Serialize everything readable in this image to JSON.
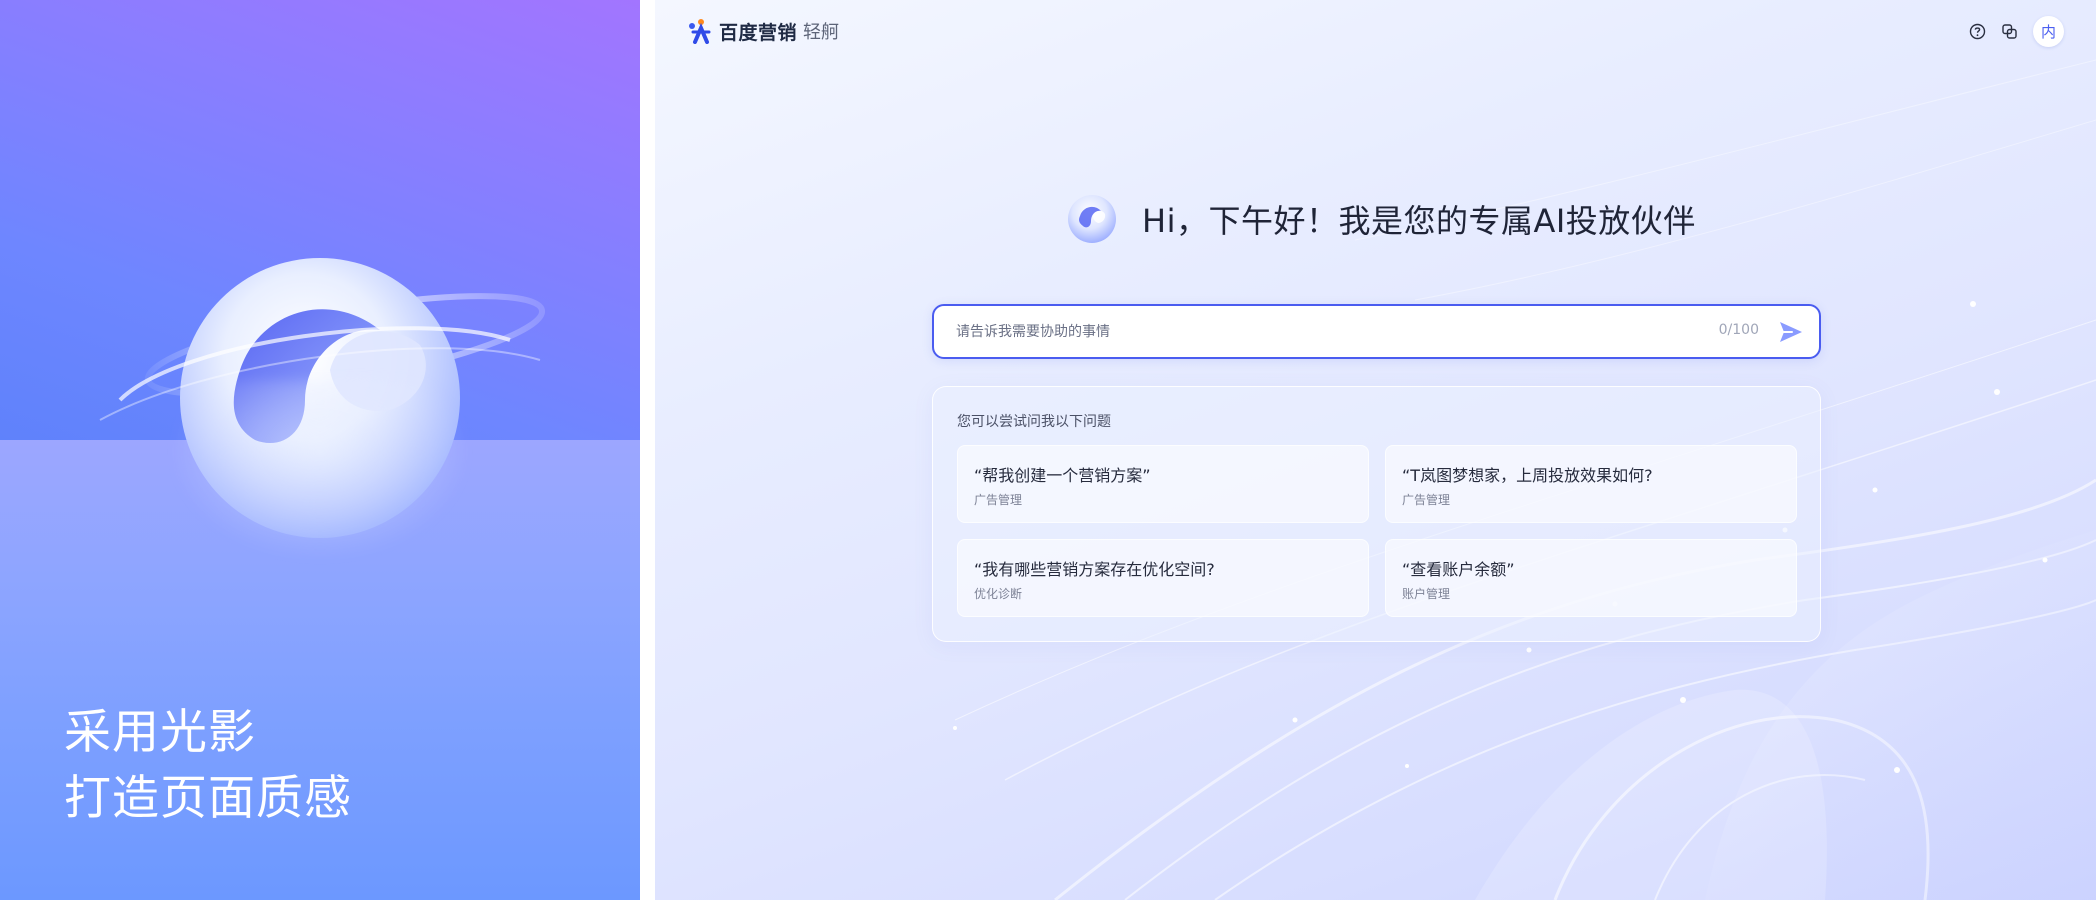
{
  "showcase": {
    "slogan_line1": "采用光影",
    "slogan_line2": "打造页面质感"
  },
  "header": {
    "brand": "百度营销",
    "product": "轻舸",
    "avatar_text": "内",
    "icons": [
      "help-icon",
      "switch-copy-icon"
    ]
  },
  "greeting": "Hi，下午好！我是您的专属AI投放伙伴",
  "ask": {
    "placeholder": "请告诉我需要协助的事情",
    "counter": "0/100"
  },
  "suggestions": {
    "title": "您可以尝试问我以下问题",
    "items": [
      {
        "question": "“帮我创建一个营销方案”",
        "tag": "广告管理"
      },
      {
        "question": "“T岚图梦想家，上周投放效果如何?",
        "tag": "广告管理"
      },
      {
        "question": "“我有哪些营销方案存在优化空间?",
        "tag": "优化诊断"
      },
      {
        "question": "“查看账户余额”",
        "tag": "账户管理"
      }
    ]
  },
  "colors": {
    "accent": "#4a5cf0",
    "left_top": "#8c7dff",
    "left_bottom": "#7ea0ff"
  }
}
